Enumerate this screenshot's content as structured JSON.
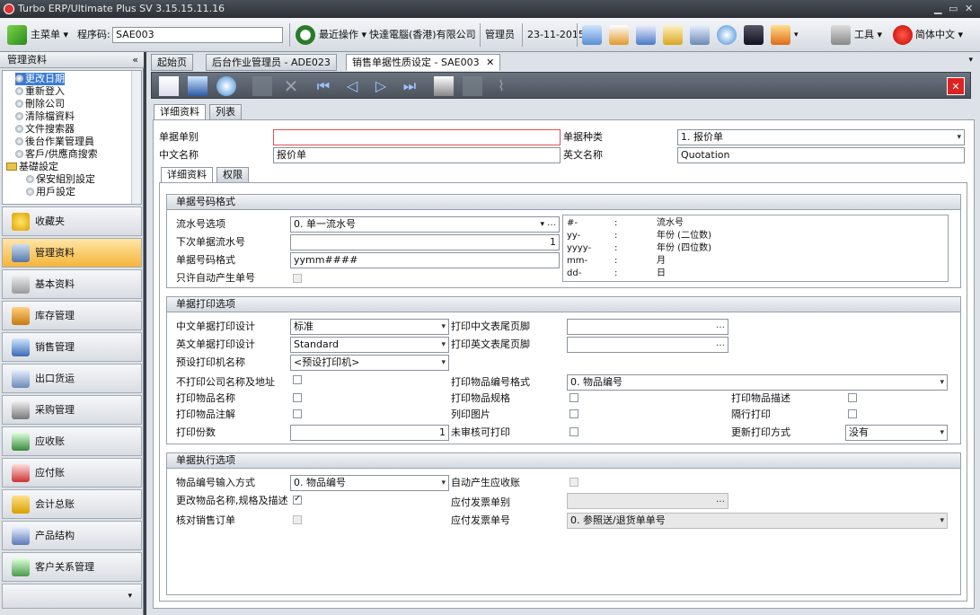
{
  "window": {
    "title": "Turbo ERP/Ultimate Plus SV 3.15.15.11.16"
  },
  "toolbar": {
    "main_menu": "主菜单",
    "program_label": "程序码:",
    "program_code": "SAE003",
    "recent": "最近操作",
    "company": "快達電腦(香港)有限公司",
    "user": "管理员",
    "date": "23-11-2015",
    "tools": "工具",
    "language": "简体中文"
  },
  "left": {
    "header": "管理资料",
    "tree": [
      "更改日期",
      "重新登入",
      "刪除公司",
      "清除檔資料",
      "文件搜索器",
      "後台作業管理員",
      "客戶/供應商搜索",
      "基礎設定",
      "保安組別設定",
      "用戶設定"
    ],
    "nav": [
      "收藏夹",
      "管理资料",
      "基本资料",
      "库存管理",
      "销售管理",
      "出口货运",
      "采购管理",
      "应收账",
      "应付账",
      "会计总账",
      "产品结构",
      "客户关系管理"
    ]
  },
  "tabs": [
    "起始页",
    "后台作业管理员 - ADE023",
    "销售单据性质设定 - SAE003"
  ],
  "subtabs": {
    "outer": [
      "详细资料",
      "列表"
    ],
    "inner": [
      "详细资料",
      "权限"
    ]
  },
  "form": {
    "doc_type_label": "单据单别",
    "doc_type_value": "",
    "doc_kind_label": "单据种类",
    "doc_kind_value": "1. 报价单",
    "cn_name_label": "中文名称",
    "cn_name_value": "报价单",
    "en_name_label": "英文名称",
    "en_name_value": "Quotation"
  },
  "numfmt": {
    "title": "单据号码格式",
    "serial_opt_label": "流水号选项",
    "serial_opt_value": "0. 单一流水号",
    "next_serial_label": "下次单据流水号",
    "next_serial_value": "1",
    "format_label": "单据号码格式",
    "format_value": "yymm####",
    "auto_only_label": "只许自动产生单号",
    "legend": [
      [
        "#-",
        ":",
        "流水号"
      ],
      [
        "yy-",
        ":",
        "年份 (二位数)"
      ],
      [
        "yyyy-",
        ":",
        "年份 (四位数)"
      ],
      [
        "mm-",
        ":",
        "月"
      ],
      [
        "dd-",
        ":",
        "日"
      ]
    ]
  },
  "print": {
    "title": "单据打印选项",
    "cn_design_label": "中文单据打印设计",
    "cn_design_value": "标准",
    "en_design_label": "英文单据打印设计",
    "en_design_value": "Standard",
    "printer_label": "预设打印机名称",
    "printer_value": "<预设打印机>",
    "cn_footer_label": "打印中文表尾页脚",
    "en_footer_label": "打印英文表尾页脚",
    "no_company_label": "不打印公司名称及地址",
    "item_no_fmt_label": "打印物品编号格式",
    "item_no_fmt_value": "0. 物品编号",
    "item_name_label": "打印物品名称",
    "item_spec_label": "打印物品规格",
    "item_desc_label": "打印物品描述",
    "item_note_label": "打印物品注解",
    "pic_label": "列印图片",
    "alt_label": "隔行打印",
    "copies_label": "打印份数",
    "copies_value": "1",
    "unapproved_label": "未审核可打印",
    "update_label": "更新打印方式",
    "update_value": "没有"
  },
  "exec": {
    "title": "单据执行选项",
    "input_label": "物品编号输入方式",
    "input_value": "0. 物品编号",
    "auto_ar_label": "自动产生应收账",
    "edit_label": "更改物品名称,规格及描述",
    "ap_type_label": "应付发票单别",
    "check_label": "核对销售订单",
    "ap_no_label": "应付发票单号",
    "ap_no_value": "0. 参照送/退货单单号"
  }
}
